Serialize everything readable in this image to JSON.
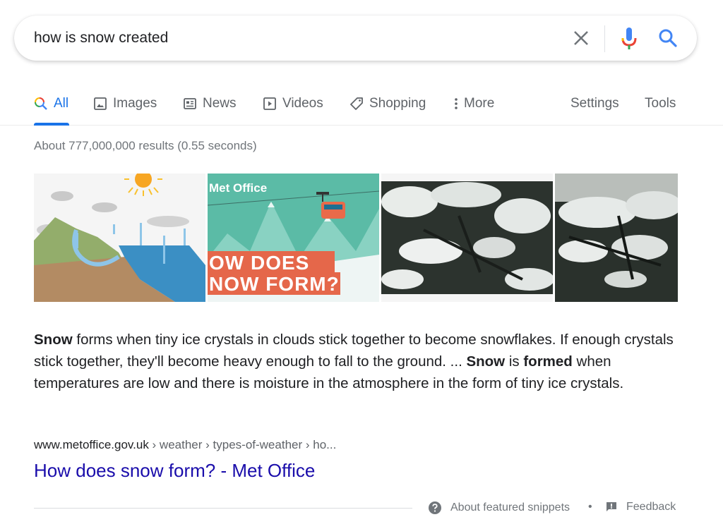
{
  "search": {
    "query": "how is snow created",
    "clear_icon": "close-icon",
    "voice_icon": "microphone-icon",
    "search_icon": "search-icon"
  },
  "tabs": [
    {
      "label": "All",
      "icon": "search-multicolor-icon",
      "active": true
    },
    {
      "label": "Images",
      "icon": "image-icon"
    },
    {
      "label": "News",
      "icon": "newspaper-icon"
    },
    {
      "label": "Videos",
      "icon": "play-icon"
    },
    {
      "label": "Shopping",
      "icon": "tag-icon"
    },
    {
      "label": "More",
      "icon": "vertical-dots-icon"
    }
  ],
  "tools": {
    "settings_label": "Settings",
    "tools_label": "Tools"
  },
  "result_stats": "About 777,000,000 results (0.55 seconds)",
  "images": [
    {
      "alt": "Water cycle diagram"
    },
    {
      "alt": "Met Office - How does snow form?",
      "caption_brand": "Met Office",
      "caption_line1": "OW DOES",
      "caption_line2": "NOW FORM?"
    },
    {
      "alt": "Snow on pine branches"
    },
    {
      "alt": "Snow-covered fir branches"
    }
  ],
  "snippet": {
    "parts": [
      {
        "text": "Snow",
        "bold": true
      },
      {
        "text": " forms when tiny ice crystals in clouds stick together to become snowflakes. If enough crystals stick together, they'll become heavy enough to fall to the ground. ... "
      },
      {
        "text": "Snow",
        "bold": true
      },
      {
        "text": " is "
      },
      {
        "text": "formed",
        "bold": true
      },
      {
        "text": " when temperatures are low and there is moisture in the atmosphere in the form of tiny ice crystals."
      }
    ]
  },
  "result": {
    "domain": "www.metoffice.gov.uk",
    "breadcrumbs": " › weather › types-of-weather › ho...",
    "title": "How does snow form? - Met Office"
  },
  "footer": {
    "about_label": "About featured snippets",
    "separator": "•",
    "feedback_label": "Feedback"
  },
  "colors": {
    "accent": "#1a73e8",
    "link": "#1a0dab",
    "muted": "#70757a"
  }
}
